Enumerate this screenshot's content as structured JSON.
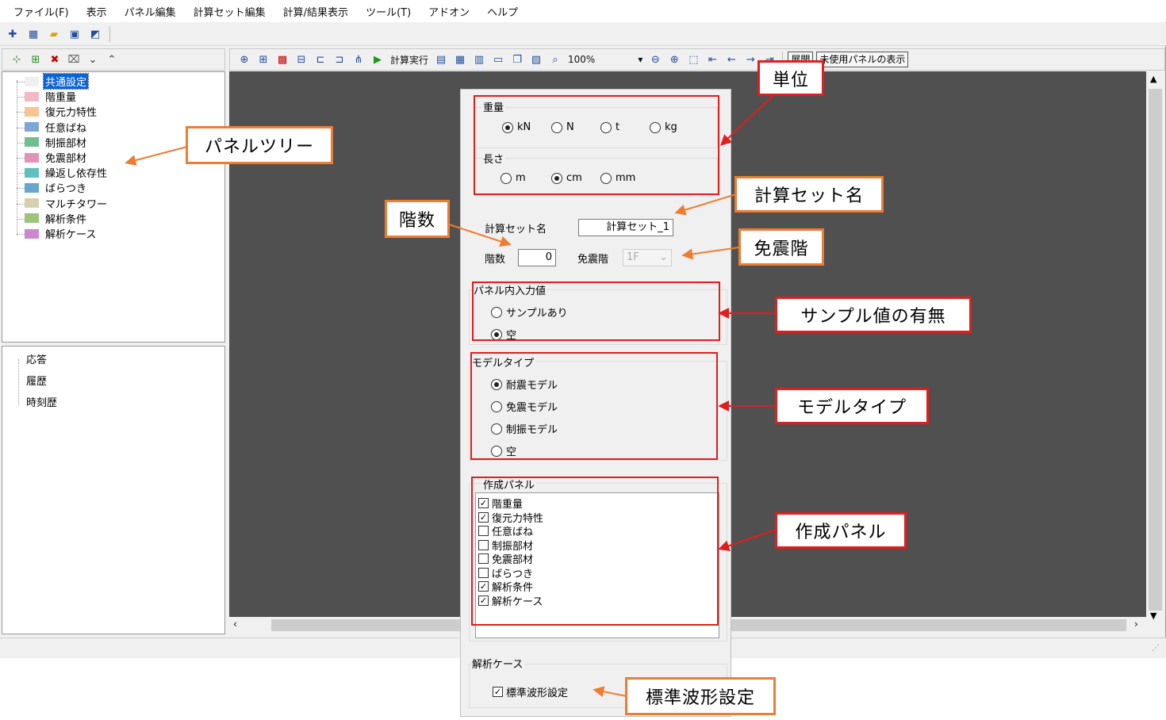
{
  "menu": [
    "ファイル(F)",
    "表示",
    "パネル編集",
    "計算セット編集",
    "計算/結果表示",
    "ツール(T)",
    "アドオン",
    "ヘルプ"
  ],
  "toolbar": {
    "run_label": "計算実行",
    "zoom": "100%",
    "expand_label": "展開",
    "show_unused_label": "未使用パネルの表示"
  },
  "tree": {
    "items": [
      {
        "label": "共通設定",
        "color": "#f0f0f0"
      },
      {
        "label": "階重量",
        "color": "#f4b8c4"
      },
      {
        "label": "復元力特性",
        "color": "#f7c58f"
      },
      {
        "label": "任意ばね",
        "color": "#7fa6d6"
      },
      {
        "label": "制振部材",
        "color": "#6fbf8e"
      },
      {
        "label": "免震部材",
        "color": "#e493b8"
      },
      {
        "label": "繰返し依存性",
        "color": "#5fbfbf"
      },
      {
        "label": "ばらつき",
        "color": "#6aa5cc"
      },
      {
        "label": "マルチタワー",
        "color": "#d6d0b0"
      },
      {
        "label": "解析条件",
        "color": "#9cc47a"
      },
      {
        "label": "解析ケース",
        "color": "#cc88cc"
      }
    ]
  },
  "results": [
    "応答",
    "履歴",
    "時刻歴"
  ],
  "dialog": {
    "weight": {
      "title": "重量",
      "options": [
        "kN",
        "N",
        "t",
        "kg"
      ],
      "selected": 0
    },
    "length": {
      "title": "長さ",
      "options": [
        "m",
        "cm",
        "mm"
      ],
      "selected": 1
    },
    "calcset_label": "計算セット名",
    "calcset_value": "計算セット_1",
    "floors_label": "階数",
    "floors_value": "0",
    "iso_floor_label": "免震階",
    "iso_floor_value": "1F",
    "panel_input": {
      "title": "パネル内入力値",
      "options": [
        "サンプルあり",
        "空"
      ],
      "selected": 1
    },
    "model_type": {
      "title": "モデルタイプ",
      "options": [
        "耐震モデル",
        "免震モデル",
        "制振モデル",
        "空"
      ],
      "selected": 0
    },
    "create_panels": {
      "title": "作成パネル",
      "items": [
        {
          "label": "階重量",
          "checked": true
        },
        {
          "label": "復元力特性",
          "checked": true
        },
        {
          "label": "任意ばね",
          "checked": false
        },
        {
          "label": "制振部材",
          "checked": false
        },
        {
          "label": "免震部材",
          "checked": false
        },
        {
          "label": "ばらつき",
          "checked": false
        },
        {
          "label": "解析条件",
          "checked": true
        },
        {
          "label": "解析ケース",
          "checked": true
        }
      ]
    },
    "analysis_case": {
      "title": "解析ケース",
      "std_wave_label": "標準波形設定",
      "std_wave_checked": true
    }
  },
  "callouts": {
    "unit": "単位",
    "panel_tree": "パネルツリー",
    "calcset_name": "計算セット名",
    "floors": "階数",
    "iso_floor": "免震階",
    "sample": "サンプル値の有無",
    "model_type": "モデルタイプ",
    "create_panel": "作成パネル",
    "std_wave": "標準波形設定"
  },
  "colors": {
    "accent_red": "#e31c1c",
    "accent_orange": "#ed7d31",
    "canvas": "#505050"
  }
}
